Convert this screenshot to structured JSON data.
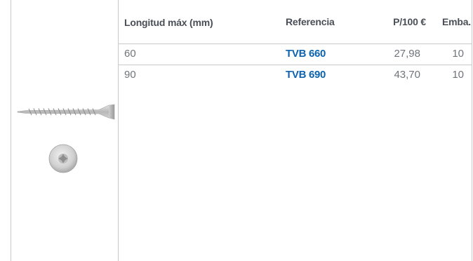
{
  "table": {
    "headers": {
      "length": "Longitud máx (mm)",
      "reference": "Referencia",
      "price": "P/100 €",
      "pack": "Emba."
    },
    "rows": [
      {
        "length": "60",
        "reference": "TVB 660",
        "price": "27,98",
        "pack": "10"
      },
      {
        "length": "90",
        "reference": "TVB 690",
        "price": "43,70",
        "pack": "10"
      }
    ]
  },
  "colors": {
    "reference_link": "#0c63b0",
    "border": "#c9c9c9",
    "text": "#6f747b"
  },
  "icons": {
    "product_side": "screw-side-view-image",
    "product_head": "screw-head-view-image"
  }
}
